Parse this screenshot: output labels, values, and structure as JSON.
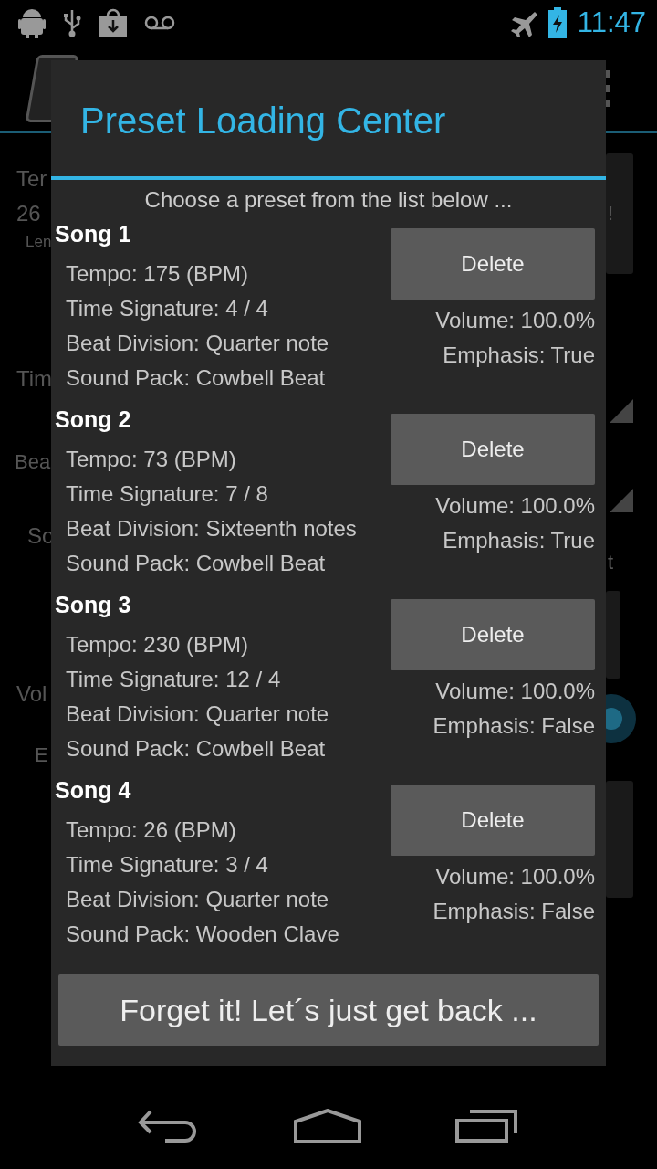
{
  "status_bar": {
    "time": "11:47"
  },
  "background": {
    "left_labels": [
      "Ter",
      "26",
      "Len",
      "Tim",
      "Bea",
      "So",
      "Vol",
      "E"
    ],
    "right_labels": [
      "!",
      "t"
    ]
  },
  "dialog": {
    "title": "Preset Loading Center",
    "subtitle": "Choose a preset from the list below ...",
    "presets": [
      {
        "name": "Song 1",
        "tempo": "Tempo: 175 (BPM)",
        "time_signature": "Time Signature: 4 / 4",
        "beat_division": "Beat Division: Quarter note",
        "sound_pack": "Sound Pack: Cowbell Beat",
        "volume": "Volume: 100.0%",
        "emphasis": "Emphasis: True",
        "delete": "Delete"
      },
      {
        "name": "Song 2",
        "tempo": "Tempo: 73 (BPM)",
        "time_signature": "Time Signature: 7 / 8",
        "beat_division": "Beat Division: Sixteenth notes",
        "sound_pack": "Sound Pack: Cowbell Beat",
        "volume": "Volume: 100.0%",
        "emphasis": "Emphasis: True",
        "delete": "Delete"
      },
      {
        "name": "Song 3",
        "tempo": "Tempo: 230 (BPM)",
        "time_signature": "Time Signature: 12 / 4",
        "beat_division": "Beat Division: Quarter note",
        "sound_pack": "Sound Pack: Cowbell Beat",
        "volume": "Volume: 100.0%",
        "emphasis": "Emphasis: False",
        "delete": "Delete"
      },
      {
        "name": "Song 4",
        "tempo": "Tempo: 26 (BPM)",
        "time_signature": "Time Signature: 3 / 4",
        "beat_division": "Beat Division: Quarter note",
        "sound_pack": "Sound Pack: Wooden Clave",
        "volume": "Volume: 100.0%",
        "emphasis": "Emphasis: False",
        "delete": "Delete"
      }
    ],
    "back_button": "Forget it! Let´s just get back ..."
  }
}
